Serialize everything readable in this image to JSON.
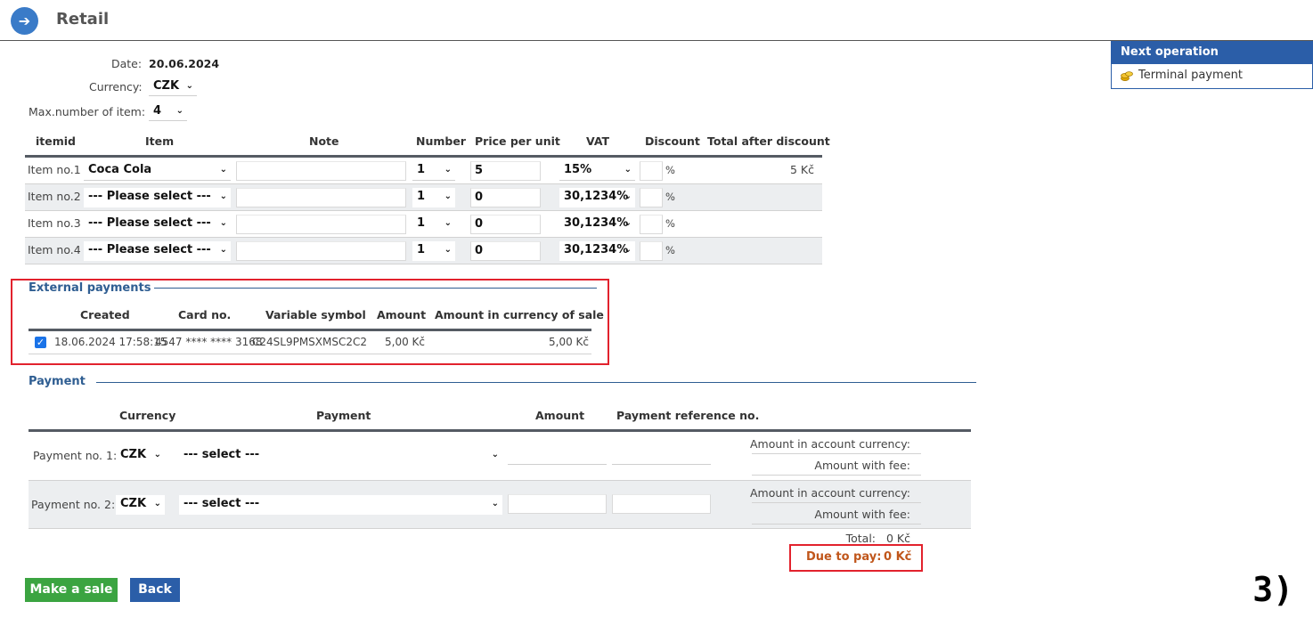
{
  "header": {
    "icon": "arrow-right-icon",
    "title": "Retail"
  },
  "form": {
    "date_label": "Date:",
    "date_value": "20.06.2024",
    "currency_label": "Currency:",
    "currency_value": "CZK",
    "maxitems_label": "Max.number of item:",
    "maxitems_value": "4"
  },
  "items_table": {
    "headers": [
      "itemid",
      "Item",
      "Note",
      "Number",
      "Price per unit",
      "VAT",
      "Discount",
      "Total after discount"
    ],
    "rows": [
      {
        "id": "Item no.1",
        "item": "Coca Cola",
        "note": "",
        "number": "1",
        "price": "5",
        "vat": "15%",
        "discount": "",
        "pct": "%",
        "total": "5 Kč"
      },
      {
        "id": "Item no.2",
        "item": "--- Please select ---",
        "note": "",
        "number": "1",
        "price": "0",
        "vat": "30,1234%",
        "discount": "",
        "pct": "%",
        "total": ""
      },
      {
        "id": "Item no.3",
        "item": "--- Please select ---",
        "note": "",
        "number": "1",
        "price": "0",
        "vat": "30,1234%",
        "discount": "",
        "pct": "%",
        "total": ""
      },
      {
        "id": "Item no.4",
        "item": "--- Please select ---",
        "note": "",
        "number": "1",
        "price": "0",
        "vat": "30,1234%",
        "discount": "",
        "pct": "%",
        "total": ""
      }
    ]
  },
  "external_payments": {
    "title": "External payments",
    "headers": [
      "Created",
      "Card no.",
      "Variable symbol",
      "Amount",
      "Amount in currency of sale"
    ],
    "rows": [
      {
        "checked": true,
        "created": "18.06.2024 17:58:15",
        "card": "4547 **** **** 3168",
        "symbol": "C24SL9PMSXMSC2C2",
        "amount": "5,00 Kč",
        "amount_sale": "5,00 Kč"
      }
    ]
  },
  "payment": {
    "title": "Payment",
    "headers": [
      "Currency",
      "Payment",
      "Amount",
      "Payment reference no."
    ],
    "rows": [
      {
        "label": "Payment no. 1:",
        "currency": "CZK",
        "method": "--- select ---",
        "amount": "",
        "reference": "",
        "acct_label": "Amount in account currency:",
        "fee_label": "Amount with fee:"
      },
      {
        "label": "Payment no. 2:",
        "currency": "CZK",
        "method": "--- select ---",
        "amount": "",
        "reference": "",
        "acct_label": "Amount in account currency:",
        "fee_label": "Amount with fee:"
      }
    ],
    "total_label": "Total:",
    "total_value": "0 Kč",
    "due_label": "Due to pay:",
    "due_value": "0 Kč"
  },
  "buttons": {
    "make_sale": "Make a sale",
    "back": "Back"
  },
  "next_operation": {
    "title": "Next operation",
    "item": "Terminal payment",
    "item_icon": "coins-icon"
  },
  "annotation": "3)",
  "colors": {
    "accent_blue": "#2b5ea8",
    "green": "#3ba441",
    "highlight_red": "#e2222d",
    "due_orange": "#c0561b"
  }
}
